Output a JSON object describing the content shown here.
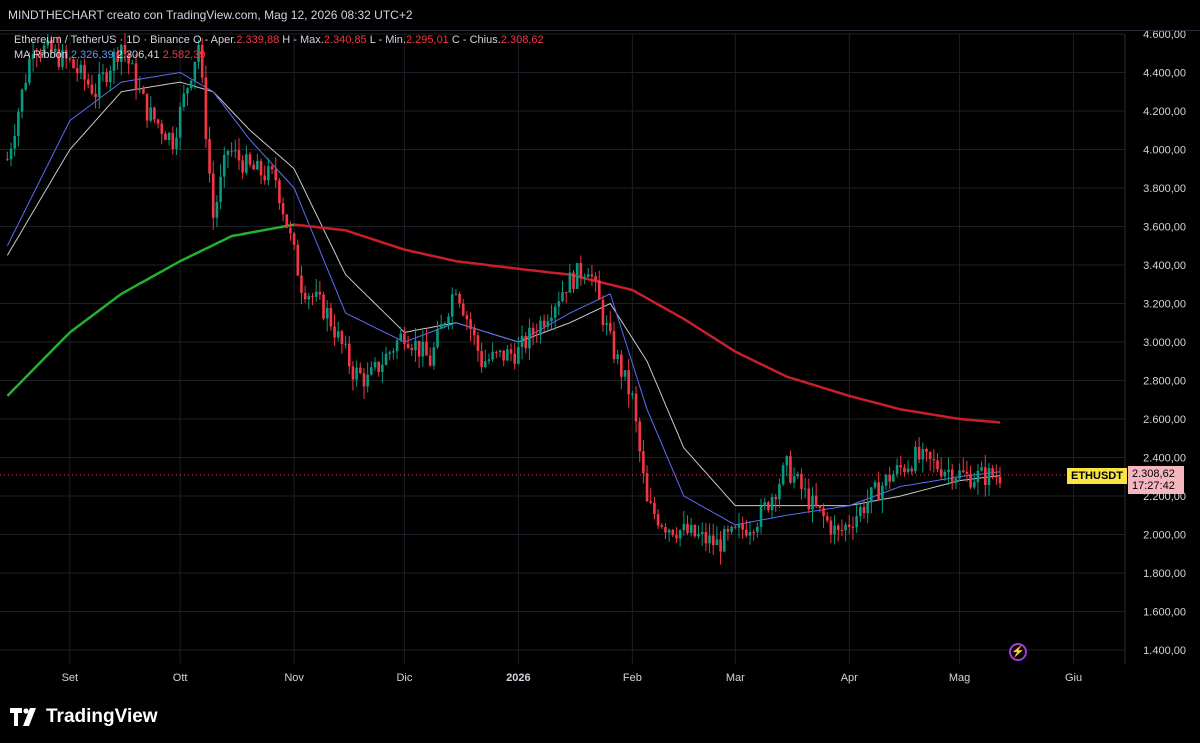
{
  "header": {
    "watermark_text": "MINDTHECHART creato con TradingView.com, Mag 12, 2026 08:32 UTC+2"
  },
  "legend": {
    "symbol_text": "Ethereum / TetherUS · 1D · Binance",
    "open_label": "O - Aper.",
    "open_value": "2.339,88",
    "high_label": "H - Max.",
    "high_value": "2.340,85",
    "low_label": "L - Min.",
    "low_value": "2.295,01",
    "close_label": "C - Chius.",
    "close_value": "2.308,62",
    "ribbon_label": "MA Ribbon",
    "ribbon_values": [
      "2.326,39",
      "2.306,41",
      "2.582,39"
    ]
  },
  "price_tag": {
    "symbol": "ETHUSDT",
    "price": "2.308,62",
    "countdown": "17:27:42"
  },
  "brand": {
    "name": "TradingView"
  },
  "icons": {
    "flash": "flash-icon",
    "logo": "tradingview-logo-icon"
  },
  "colors": {
    "background": "#000000",
    "up": "#089981",
    "down": "#f23645",
    "ma_fast": "#5b6cf6",
    "ma_mid": "#c9c9c9",
    "ma_long_up": "#22b22b",
    "ma_long_down": "#c8202a",
    "price_tag_bg": "#f6b6c0",
    "symbol_tag_bg": "#f7e542"
  },
  "chart_data": {
    "type": "line",
    "title": "Ethereum / TetherUS · 1D · Binance",
    "x_tick_labels": [
      "Set",
      "Ott",
      "Nov",
      "Dic",
      "2026",
      "Feb",
      "Mar",
      "Apr",
      "Mag",
      "Giu"
    ],
    "y_tick_labels": [
      "4.600,00",
      "4.400,00",
      "4.200,00",
      "4.000,00",
      "3.800,00",
      "3.600,00",
      "3.400,00",
      "3.200,00",
      "3.000,00",
      "2.800,00",
      "2.600,00",
      "2.400,00",
      "2.200,00",
      "2.000,00",
      "1.800,00",
      "1.600,00",
      "1.400,00"
    ],
    "ylim": [
      1400,
      4600
    ],
    "grid": true,
    "series": [
      {
        "name": "Ethereum / TetherUS",
        "x": [
          "2025-08-15",
          "2025-08-22",
          "2025-09-01",
          "2025-09-08",
          "2025-09-15",
          "2025-09-22",
          "2025-09-29",
          "2025-10-06",
          "2025-10-10",
          "2025-10-14",
          "2025-10-20",
          "2025-10-27",
          "2025-11-03",
          "2025-11-10",
          "2025-11-17",
          "2025-11-21",
          "2025-12-01",
          "2025-12-08",
          "2025-12-15",
          "2025-12-22",
          "2026-01-01",
          "2026-01-07",
          "2026-01-14",
          "2026-01-20",
          "2026-01-26",
          "2026-02-01",
          "2026-02-05",
          "2026-02-10",
          "2026-02-17",
          "2026-02-24",
          "2026-03-01",
          "2026-03-08",
          "2026-03-15",
          "2026-03-22",
          "2026-03-29",
          "2026-04-05",
          "2026-04-12",
          "2026-04-19",
          "2026-04-26",
          "2026-05-03",
          "2026-05-12"
        ],
        "values": [
          3950,
          4550,
          4450,
          4300,
          4550,
          4200,
          4050,
          4550,
          3650,
          4000,
          3900,
          3850,
          3300,
          3150,
          2850,
          2800,
          3050,
          2900,
          3300,
          2900,
          2950,
          3100,
          3300,
          3400,
          3000,
          2700,
          2150,
          2050,
          2000,
          1950,
          2000,
          2100,
          2350,
          2150,
          2000,
          2150,
          2300,
          2400,
          2350,
          2300,
          2309
        ]
      },
      {
        "name": "MA Ribbon 1",
        "x": [
          "2025-08-15",
          "2025-09-01",
          "2025-09-15",
          "2025-10-01",
          "2025-10-10",
          "2025-10-20",
          "2025-11-01",
          "2025-11-15",
          "2025-12-01",
          "2025-12-15",
          "2026-01-01",
          "2026-01-15",
          "2026-01-26",
          "2026-02-05",
          "2026-02-15",
          "2026-03-01",
          "2026-03-15",
          "2026-04-01",
          "2026-04-15",
          "2026-05-01",
          "2026-05-12"
        ],
        "values": [
          3500,
          4150,
          4350,
          4400,
          4300,
          4050,
          3800,
          3150,
          3000,
          3100,
          3000,
          3150,
          3250,
          2650,
          2200,
          2050,
          2100,
          2150,
          2250,
          2300,
          2326
        ]
      },
      {
        "name": "MA Ribbon 2",
        "x": [
          "2025-08-15",
          "2025-09-01",
          "2025-09-15",
          "2025-10-01",
          "2025-10-10",
          "2025-10-20",
          "2025-11-01",
          "2025-11-15",
          "2025-12-01",
          "2025-12-15",
          "2026-01-01",
          "2026-01-15",
          "2026-01-26",
          "2026-02-05",
          "2026-02-15",
          "2026-03-01",
          "2026-03-15",
          "2026-04-01",
          "2026-04-15",
          "2026-05-01",
          "2026-05-12"
        ],
        "values": [
          3450,
          4000,
          4300,
          4350,
          4300,
          4100,
          3900,
          3350,
          3050,
          3100,
          3000,
          3100,
          3200,
          2900,
          2450,
          2150,
          2150,
          2150,
          2200,
          2280,
          2306
        ]
      },
      {
        "name": "MA Ribbon 3",
        "x": [
          "2025-08-15",
          "2025-09-01",
          "2025-09-15",
          "2025-10-01",
          "2025-10-15",
          "2025-11-01",
          "2025-11-15",
          "2025-12-01",
          "2025-12-15",
          "2026-01-01",
          "2026-01-15",
          "2026-02-01",
          "2026-02-15",
          "2026-03-01",
          "2026-03-15",
          "2026-04-01",
          "2026-04-15",
          "2026-05-01",
          "2026-05-12"
        ],
        "values": [
          2720,
          3050,
          3250,
          3420,
          3550,
          3610,
          3580,
          3480,
          3420,
          3380,
          3350,
          3270,
          3120,
          2950,
          2820,
          2720,
          2650,
          2600,
          2582
        ]
      }
    ]
  }
}
